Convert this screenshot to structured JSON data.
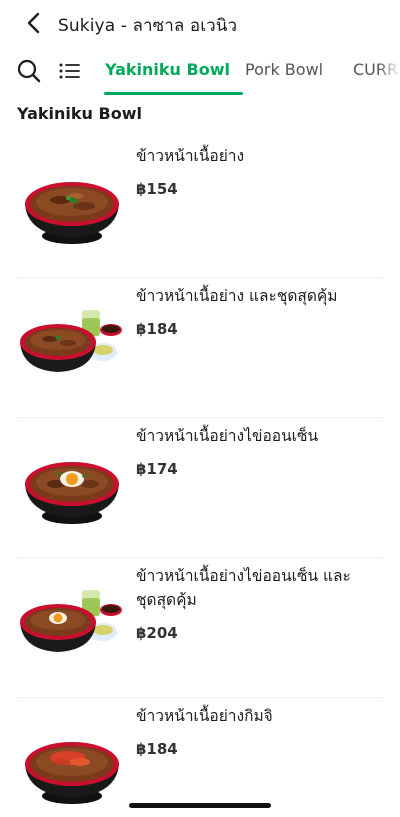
{
  "header": {
    "title": "Sukiya - ลาซาล อเวนิว",
    "back_icon": "chevron-left-icon"
  },
  "tabbar": {
    "search_icon": "search-icon",
    "menu_icon": "list-menu-icon",
    "tabs": [
      {
        "label": "Yakiniku Bowl",
        "active": true
      },
      {
        "label": "Pork Bowl",
        "active": false
      },
      {
        "label": "CURRY",
        "active": false
      }
    ],
    "accent_color": "#00a95c"
  },
  "section": {
    "title": "Yakiniku Bowl"
  },
  "items": [
    {
      "name": "ข้าวหน้าเนื้อย่าง",
      "price": "฿154"
    },
    {
      "name": "ข้าวหน้าเนื้อย่าง และชุดสุดคุ้ม",
      "price": "฿184"
    },
    {
      "name": "ข้าวหน้าเนื้อย่างไข่ออนเซ็น",
      "price": "฿174"
    },
    {
      "name": "ข้าวหน้าเนื้อย่างไข่ออนเซ็น และชุดสุดคุ้ม",
      "price": "฿204"
    },
    {
      "name": "ข้าวหน้าเนื้อย่างกิมจิ",
      "price": "฿184"
    }
  ]
}
